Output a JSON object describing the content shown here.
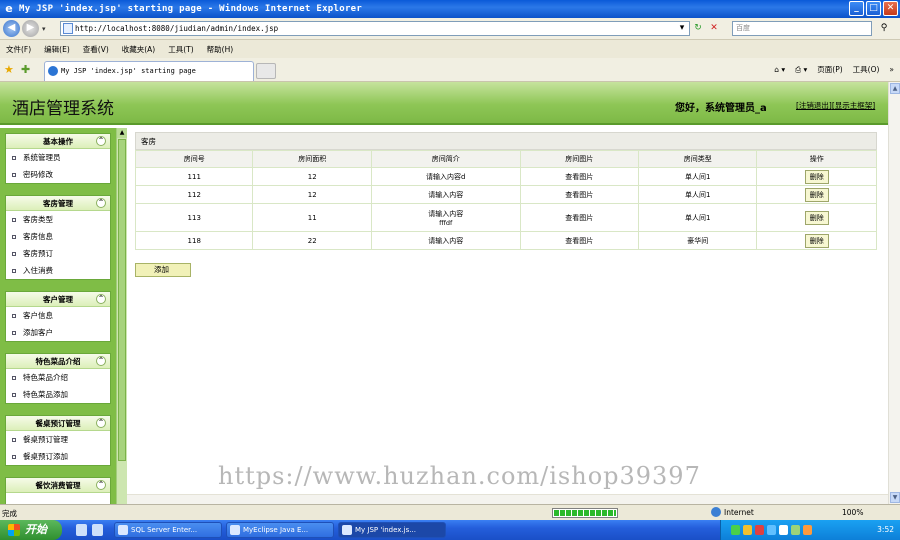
{
  "window": {
    "title": "My JSP 'index.jsp' starting page - Windows Internet Explorer"
  },
  "address": {
    "url": "http://localhost:8080/jiudian/admin/index.jsp",
    "search_placeholder": "百度"
  },
  "menu": [
    "文件(F)",
    "编辑(E)",
    "查看(V)",
    "收藏夹(A)",
    "工具(T)",
    "帮助(H)"
  ],
  "tab": {
    "label": "My JSP 'index.jsp' starting page"
  },
  "command_bar": {
    "page": "页面(P)",
    "tools": "工具(O)"
  },
  "app": {
    "title": "酒店管理系统",
    "greeting": "您好，系统管理员_a",
    "logout": "[注销退出]",
    "show_main": "[显示主框架]"
  },
  "sidebar": [
    {
      "title": "基本操作",
      "items": [
        "系统管理员",
        "密码修改"
      ]
    },
    {
      "title": "客房管理",
      "items": [
        "客房类型",
        "客房信息",
        "客房预订",
        "入住消费"
      ]
    },
    {
      "title": "客户管理",
      "items": [
        "客户信息",
        "添加客户"
      ]
    },
    {
      "title": "特色菜品介绍",
      "items": [
        "特色菜品介绍",
        "特色菜品添加"
      ]
    },
    {
      "title": "餐桌预订管理",
      "items": [
        "餐桌预订管理",
        "餐桌预订添加"
      ]
    },
    {
      "title": "餐饮消费管理",
      "items": []
    }
  ],
  "panel": {
    "caption": "客房",
    "headers": [
      "房间号",
      "房间面积",
      "房间简介",
      "房间图片",
      "房间类型",
      "操作"
    ],
    "rows": [
      {
        "no": "111",
        "area": "12",
        "intro": "请输入内容d",
        "intro2": "",
        "pic": "查看图片",
        "type": "单人间1",
        "op": "删除"
      },
      {
        "no": "112",
        "area": "12",
        "intro": "请输入内容",
        "intro2": "",
        "pic": "查看图片",
        "type": "单人间1",
        "op": "删除"
      },
      {
        "no": "113",
        "area": "11",
        "intro": "请输入内容",
        "intro2": "fffdf",
        "pic": "查看图片",
        "type": "单人间1",
        "op": "删除"
      },
      {
        "no": "118",
        "area": "22",
        "intro": "请输入内容",
        "intro2": "",
        "pic": "查看图片",
        "type": "豪华间",
        "op": "删除"
      }
    ],
    "add_label": "添加"
  },
  "watermark": "https://www.huzhan.com/ishop39397",
  "status": {
    "text": "完成",
    "zone": "Internet",
    "zoom": "100%",
    "progress": 1.0
  },
  "taskbar": {
    "start": "开始",
    "tasks": [
      "SQL Server Enter...",
      "MyEclipse Java E...",
      "My JSP 'index.js..."
    ],
    "clock": "3:52"
  }
}
